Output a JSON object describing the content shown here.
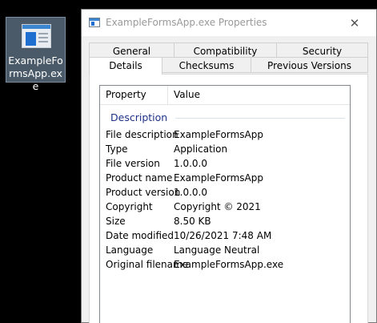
{
  "desktop_icon": {
    "label": "ExampleFormsApp.exe",
    "icon": "application-window-icon"
  },
  "window": {
    "title": "ExampleFormsApp.exe Properties",
    "close_glyph": "✕",
    "tabs_row1": [
      "General",
      "Compatibility",
      "Security"
    ],
    "tabs_row2": [
      "Details",
      "Checksums",
      "Previous Versions"
    ],
    "active_tab": "Details"
  },
  "details": {
    "columns": [
      "Property",
      "Value"
    ],
    "group": "Description",
    "rows": [
      {
        "property": "File description",
        "value": "ExampleFormsApp"
      },
      {
        "property": "Type",
        "value": "Application"
      },
      {
        "property": "File version",
        "value": "1.0.0.0"
      },
      {
        "property": "Product name",
        "value": "ExampleFormsApp"
      },
      {
        "property": "Product version",
        "value": "1.0.0.0"
      },
      {
        "property": "Copyright",
        "value": "Copyright ©  2021"
      },
      {
        "property": "Size",
        "value": "8.50 KB"
      },
      {
        "property": "Date modified",
        "value": "10/26/2021 7:48 AM"
      },
      {
        "property": "Language",
        "value": "Language Neutral"
      },
      {
        "property": "Original filename",
        "value": "ExampleFormsApp.exe"
      }
    ]
  }
}
